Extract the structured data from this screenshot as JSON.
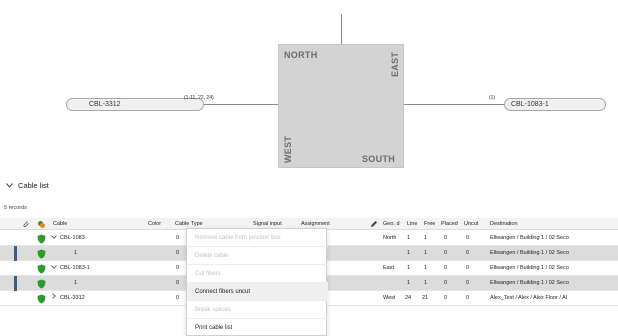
{
  "diagram": {
    "closure": {
      "north": "NORTH",
      "east": "EAST",
      "west": "WEST",
      "south": "SOUTH"
    },
    "left_cable": {
      "label": "CBL-3312",
      "fibers": "(1-11, 22, 24)"
    },
    "right_cable": {
      "label": "CBL-1083-1",
      "fibers": "(1)"
    }
  },
  "section": {
    "title": "Cable list",
    "records": "5 records"
  },
  "table": {
    "headers": {
      "cable": "Cable",
      "color": "Color",
      "cable_type": "Cable Type",
      "signal_input": "Signal input",
      "assignment": "Assignment",
      "geo": "Geo. d",
      "line": "Line",
      "free": "Free",
      "placed": "Placed",
      "uncut": "Uncut",
      "destination": "Destination"
    },
    "rows": [
      {
        "cable": "CBL-1083",
        "color": "0",
        "geo": "North",
        "line": "1",
        "free": "1",
        "placed": "0",
        "uncut": "0",
        "destination": "Ellwangen / Building 1 / 02 Seco"
      },
      {
        "cable": "1",
        "color": "0",
        "geo": "",
        "line": "1",
        "free": "1",
        "placed": "0",
        "uncut": "0",
        "destination": "Ellwangen / Building 1 / 02 Seco"
      },
      {
        "cable": "CBL-1083-1",
        "color": "0",
        "geo": "East",
        "line": "1",
        "free": "1",
        "placed": "0",
        "uncut": "0",
        "destination": "Ellwangen / Building 1 / 02 Seco"
      },
      {
        "cable": "1",
        "color": "0",
        "geo": "",
        "line": "1",
        "free": "1",
        "placed": "0",
        "uncut": "0",
        "destination": "Ellwangen / Building 1 / 02 Seco"
      },
      {
        "cable": "CBL-3312",
        "color": "0",
        "geo": "West",
        "line": "24",
        "free": "21",
        "placed": "0",
        "uncut": "0",
        "destination": "Alex_Test / Alex / Alex Floor / Al"
      }
    ]
  },
  "context_menu": {
    "items": [
      {
        "label": "Remove cable from junction box",
        "enabled": false
      },
      {
        "label": "Delete cable",
        "enabled": false
      },
      {
        "label": "Cut fibers",
        "enabled": false
      },
      {
        "label": "Connect fibers uncut",
        "enabled": true
      },
      {
        "label": "Break splices",
        "enabled": false
      },
      {
        "label": "Print cable list",
        "enabled": true
      }
    ]
  },
  "colors": {
    "shield_green": "#2e9a2e",
    "selection_bar": "#3a5d86",
    "closure_fill": "#d3d3d3"
  }
}
